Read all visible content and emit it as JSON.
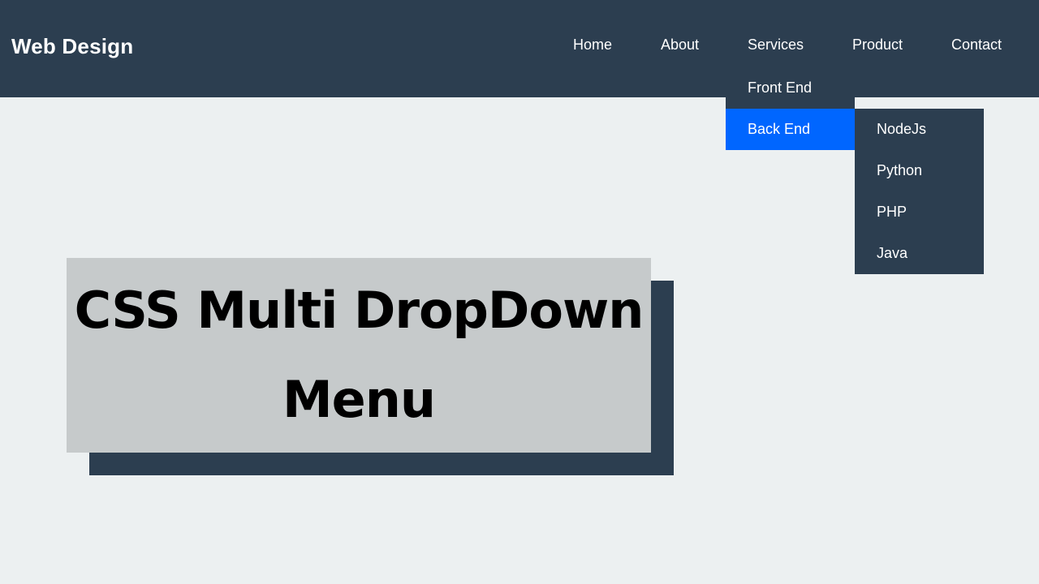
{
  "header": {
    "logo": "Web Design",
    "nav": {
      "home": "Home",
      "about": "About",
      "services": "Services",
      "product": "Product",
      "contact": "Contact"
    }
  },
  "services_dropdown": {
    "items": [
      {
        "label": "Front End",
        "active": false
      },
      {
        "label": "Back End",
        "active": true
      }
    ]
  },
  "backend_submenu": {
    "items": [
      "NodeJs",
      "Python",
      "PHP",
      "Java"
    ]
  },
  "banner": {
    "title": "CSS Multi DropDown Menu"
  },
  "colors": {
    "navbar": "#2c3e50",
    "page_background": "#ecf0f1",
    "active_item": "#0066ff",
    "banner_background": "#c6cacb",
    "text_light": "#ffffff"
  }
}
